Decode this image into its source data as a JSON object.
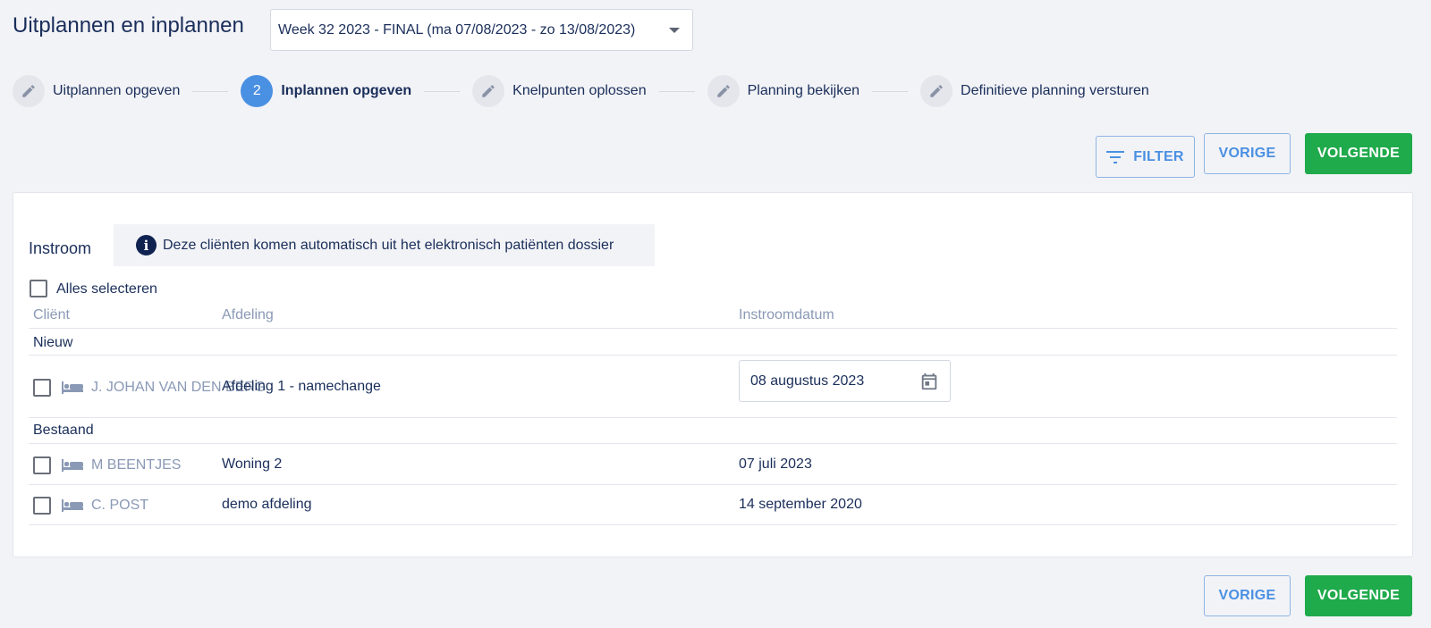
{
  "page": {
    "title": "Uitplannen en inplannen",
    "week_select": "Week 32 2023 - FINAL (ma 07/08/2023 - zo 13/08/2023)"
  },
  "stepper": {
    "steps": [
      {
        "label": "Uitplannen opgeven",
        "icon": "pencil-icon"
      },
      {
        "label": "Inplannen opgeven",
        "number": "2",
        "active": true
      },
      {
        "label": "Knelpunten oplossen",
        "icon": "pencil-icon"
      },
      {
        "label": "Planning bekijken",
        "icon": "pencil-icon"
      },
      {
        "label": "Definitieve planning versturen",
        "icon": "pencil-icon"
      }
    ]
  },
  "toolbar": {
    "filter_label": "FILTER",
    "prev_label": "VORIGE",
    "next_label": "VOLGENDE"
  },
  "panel": {
    "title": "Instroom",
    "info_text": "Deze cliënten komen automatisch uit het elektronisch patiënten dossier",
    "select_all_label": "Alles selecteren",
    "columns": {
      "client": "Cliënt",
      "afdeling": "Afdeling",
      "datum": "Instroomdatum"
    },
    "groups": {
      "nieuw": {
        "label": "Nieuw",
        "rows": [
          {
            "client": "J. JOHAN VAN DEN BERG",
            "afdeling": "Afdeling 1 - namechange",
            "datum": "08 augustus 2023"
          }
        ]
      },
      "bestaand": {
        "label": "Bestaand",
        "rows": [
          {
            "client": "M BEENTJES",
            "afdeling": "Woning 2",
            "datum": "07 juli 2023"
          },
          {
            "client": "C. POST",
            "afdeling": "demo afdeling",
            "datum": "14 september 2020"
          }
        ]
      }
    }
  },
  "footer": {
    "prev_label": "VORIGE",
    "next_label": "VOLGENDE"
  },
  "colors": {
    "accent": "#4a90e2",
    "primary_green": "#1faa4b",
    "text_dark": "#1a2e5a",
    "text_muted": "#8a99b5",
    "background": "#f2f3f7"
  }
}
